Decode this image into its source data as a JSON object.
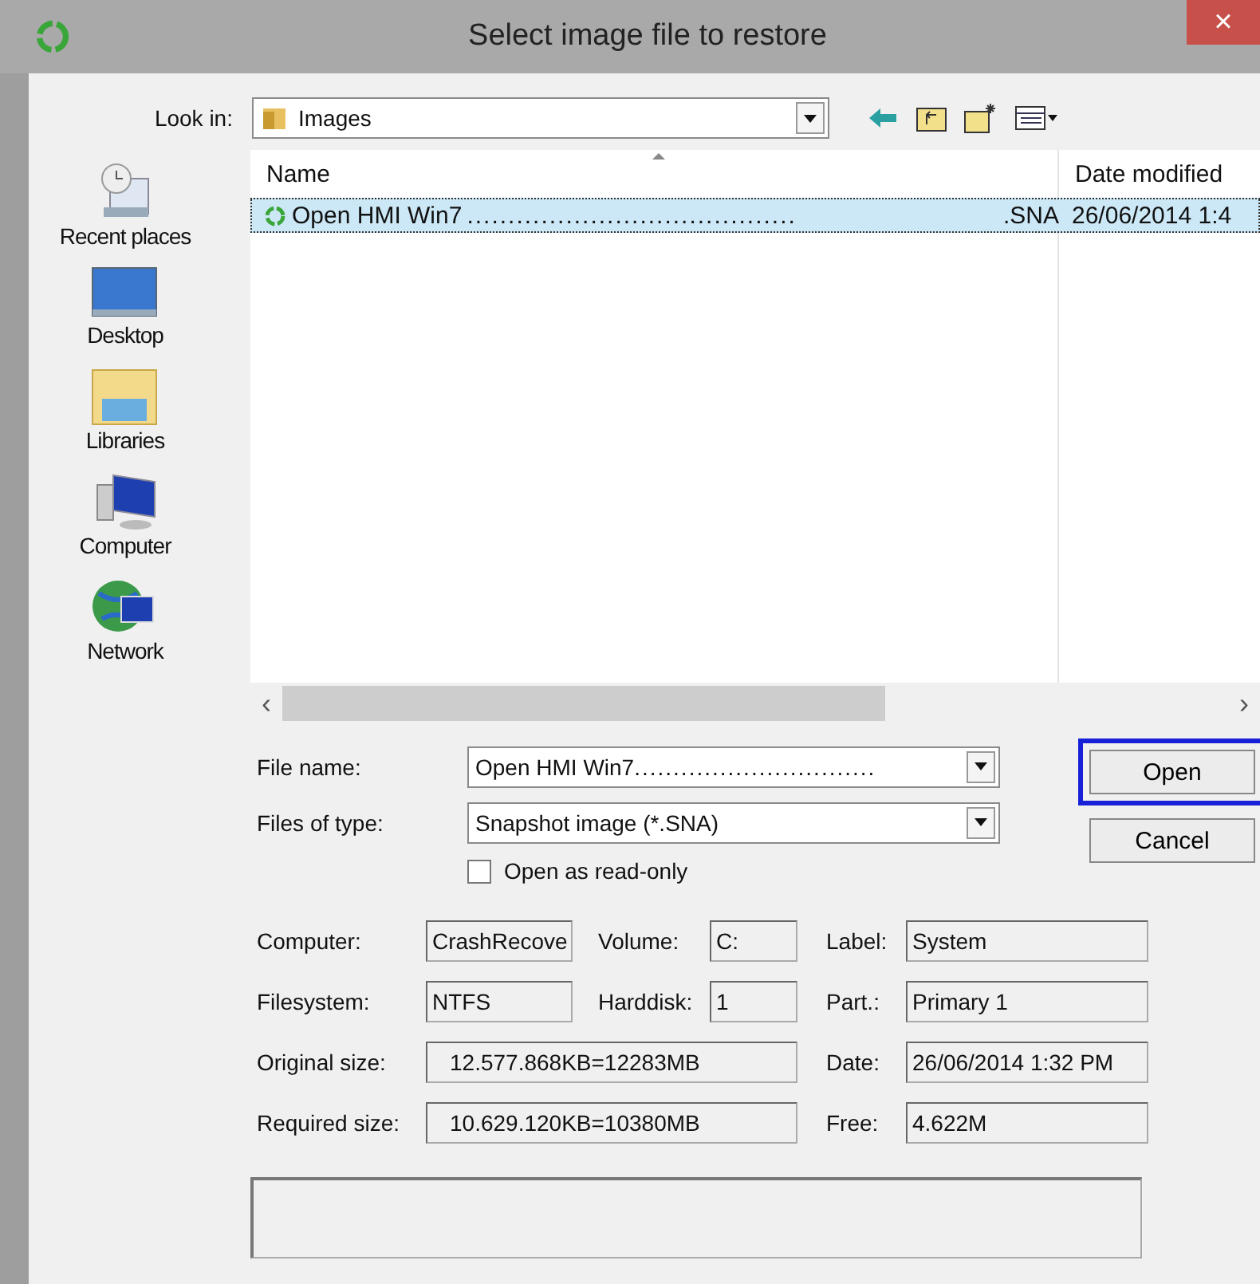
{
  "window": {
    "title": "Select image file to restore",
    "close": "×"
  },
  "look_in": {
    "label": "Look in:",
    "value": "Images"
  },
  "places": [
    {
      "label": "Recent places",
      "kind": "recent"
    },
    {
      "label": "Desktop",
      "kind": "desktop"
    },
    {
      "label": "Libraries",
      "kind": "libraries"
    },
    {
      "label": "Computer",
      "kind": "computer"
    },
    {
      "label": "Network",
      "kind": "network"
    }
  ],
  "file_list": {
    "columns": [
      "Name",
      "Date modified"
    ],
    "rows": [
      {
        "name": "Open HMI Win7",
        "leader": "........................................",
        "extension": ".SNA",
        "date": "26/06/2014 1:4",
        "selected": true
      }
    ],
    "scroll_left": "‹",
    "scroll_right": "›"
  },
  "file_name": {
    "label": "File name:",
    "value": "Open HMI Win7",
    "leader": "..............................."
  },
  "file_type": {
    "label": "Files of type:",
    "value": "Snapshot image (*.SNA)"
  },
  "read_only": {
    "label": "Open as read-only",
    "checked": false
  },
  "buttons": [
    {
      "label": "Open",
      "focused": true
    },
    {
      "label": "Cancel",
      "focused": false
    }
  ],
  "info": [
    [
      {
        "label": "Computer:",
        "value": "CrashRecove",
        "kind": "short"
      },
      {
        "label": "Volume:",
        "value": "C:",
        "kind": "tiny"
      },
      {
        "label": "Label:",
        "value": "System",
        "kind": "long"
      }
    ],
    [
      {
        "label": "Filesystem:",
        "value": "NTFS",
        "kind": "short"
      },
      {
        "label": "Harddisk:",
        "value": "1",
        "kind": "tiny"
      },
      {
        "label": "Part.:",
        "value": "Primary 1",
        "kind": "long"
      }
    ],
    [
      {
        "label": "Original size:",
        "value": "12.577.868KB=12283MB",
        "kind": "wide"
      },
      {
        "label": "Date:",
        "value": "26/06/2014 1:32 PM",
        "kind": "long"
      }
    ],
    [
      {
        "label": "Required size:",
        "value": "10.629.120KB=10380MB",
        "kind": "wide"
      },
      {
        "label": "Free:",
        "value": "4.622M",
        "kind": "long"
      }
    ]
  ]
}
